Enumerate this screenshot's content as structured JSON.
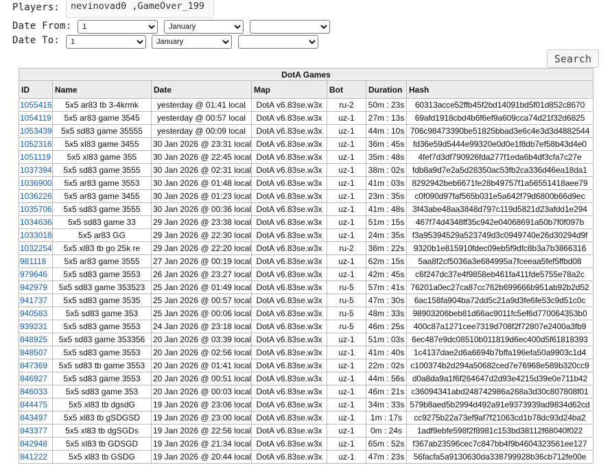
{
  "filters": {
    "players_label": "Players:",
    "players_value": "nevinovad0 ,GameOver_199",
    "date_from_label": "Date From:",
    "date_to_label": "Date To:",
    "from_day": "1",
    "from_month": "January",
    "from_year": "",
    "to_day": "1",
    "to_month": "January",
    "to_year": "",
    "search_label": "Search"
  },
  "table": {
    "title": "DotA Games",
    "headers": [
      "ID",
      "Name",
      "Date",
      "Map",
      "Bot",
      "Duration",
      "Hash"
    ],
    "rows": [
      {
        "id": "1055416",
        "name": "5x5 ar83 tb 3-4krmk",
        "date": "yesterday @ 01:41 local",
        "map": "DotA v6.83se.w3x",
        "bot": "ru-2",
        "duration": "50m : 23s",
        "hash": "60313acce52ffb45f2bd14091bd5f01d852c8670"
      },
      {
        "id": "1054119",
        "name": "5x5 ar83 game 3545",
        "date": "yesterday @ 00:57 local",
        "map": "DotA v6.83se.w3x",
        "bot": "uz-1",
        "duration": "27m : 13s",
        "hash": "69afd1918cbd4b6f6ef9a609cca74d21f32d6825"
      },
      {
        "id": "1053439",
        "name": "5x5 sd83 game 35555",
        "date": "yesterday @ 00:09 local",
        "map": "DotA v6.83se.w3x",
        "bot": "uz-1",
        "duration": "44m : 10s",
        "hash": "706c98473390be51825bbad3e6c4e3d3d4882544"
      },
      {
        "id": "1052316",
        "name": "5x5 xl83 game 3455",
        "date": "30 Jan 2026 @ 23:31 local",
        "map": "DotA v6.83se.w3x",
        "bot": "uz-1",
        "duration": "36m : 45s",
        "hash": "fd36e59d5444e99320e0d0e1f8db7ef58b43d4e0"
      },
      {
        "id": "1051119",
        "name": "5x5 xl83 game 355",
        "date": "30 Jan 2026 @ 22:45 local",
        "map": "DotA v6.83se.w3x",
        "bot": "uz-1",
        "duration": "35m : 48s",
        "hash": "4fef7d3df790926fda277f1eda6b4df3cfa7c27e"
      },
      {
        "id": "1037394",
        "name": "5x5 sd83 game 3555",
        "date": "30 Jan 2026 @ 02:31 local",
        "map": "DotA v6.83se.w3x",
        "bot": "uz-1",
        "duration": "38m : 02s",
        "hash": "fdb8a9d7e2a5d28350ac53fb2ca336d46ea18da1"
      },
      {
        "id": "1036900",
        "name": "5x5 ar83 game 3553",
        "date": "30 Jan 2026 @ 01:48 local",
        "map": "DotA v6.83se.w3x",
        "bot": "uz-1",
        "duration": "41m : 03s",
        "hash": "8292942beb6671fe28b49757f1a56551418aee79"
      },
      {
        "id": "1036226",
        "name": "5x5 ar83 game 3455",
        "date": "30 Jan 2026 @ 01:23 local",
        "map": "DotA v6.83se.w3x",
        "bot": "uz-1",
        "duration": "23m : 35s",
        "hash": "c0f090d97faf565b031e5a642f79d6800b66d9ec"
      },
      {
        "id": "1035706",
        "name": "5x5 sd83 game 3555",
        "date": "30 Jan 2026 @ 00:36 local",
        "map": "DotA v6.83se.w3x",
        "bot": "uz-1",
        "duration": "41m : 48s",
        "hash": "3f43abe48aa3848d797c119d5821d23afdd1e294"
      },
      {
        "id": "1034636",
        "name": "5x5 sd83 game 33",
        "date": "29 Jan 2026 @ 23:38 local",
        "map": "DotA v6.83se.w3x",
        "bot": "uz-1",
        "duration": "51m : 15s",
        "hash": "467f74d4348ff35c942e04068691a50b7f0f097b"
      },
      {
        "id": "1033018",
        "name": "5x5 ar83 GG",
        "date": "29 Jan 2026 @ 22:30 local",
        "map": "DotA v6.83se.w3x",
        "bot": "uz-1",
        "duration": "24m : 35s",
        "hash": "f3a95394529a523749d3c0949740e26d30294d9f"
      },
      {
        "id": "1032254",
        "name": "5x5 xl83 tb go 25k re",
        "date": "29 Jan 2026 @ 22:20 local",
        "map": "DotA v6.83se.w3x",
        "bot": "ru-2",
        "duration": "36m : 22s",
        "hash": "9320b1e815910fdec09eb5f9dfc8b3a7b3866316"
      },
      {
        "id": "981118",
        "name": "5x5 ar83 game 3555",
        "date": "27 Jan 2026 @ 00:19 local",
        "map": "DotA v6.83se.w3x",
        "bot": "uz-1",
        "duration": "62m : 15s",
        "hash": "5aa8f2cf5036a3e684995a7fceeaa5fef5ffbd08"
      },
      {
        "id": "979646",
        "name": "5x5 sd83 game 3553",
        "date": "26 Jan 2026 @ 23:27 local",
        "map": "DotA v6.83se.w3x",
        "bot": "uz-1",
        "duration": "42m : 45s",
        "hash": "c6f247dc37e4f9858eb461fa411fde5755e78a2c"
      },
      {
        "id": "942979",
        "name": "5x5 sd83 game 353523",
        "date": "25 Jan 2026 @ 01:49 local",
        "map": "DotA v6.83se.w3x",
        "bot": "ru-5",
        "duration": "57m : 41s",
        "hash": "76201a0ec27ca87cc762b699666b951ab92b2d52"
      },
      {
        "id": "941737",
        "name": "5x5 sd83 game 3535",
        "date": "25 Jan 2026 @ 00:57 local",
        "map": "DotA v6.83se.w3x",
        "bot": "ru-5",
        "duration": "47m : 30s",
        "hash": "6ac158fa904ba72dd5c21a9d3fe6fe53c9d51c0c"
      },
      {
        "id": "940583",
        "name": "5x5 sd83 game 353",
        "date": "25 Jan 2026 @ 00:06 local",
        "map": "DotA v6.83se.w3x",
        "bot": "ru-5",
        "duration": "48m : 33s",
        "hash": "98903206beb81d66ac9011fc5ef6d770064353b0"
      },
      {
        "id": "939231",
        "name": "5x5 sd83 game 3553",
        "date": "24 Jan 2026 @ 23:18 local",
        "map": "DotA v6.83se.w3x",
        "bot": "ru-5",
        "duration": "46m : 25s",
        "hash": "400c87a1271cee7319d708f2f72807e2400a3fb9"
      },
      {
        "id": "848925",
        "name": "5x5 sd83 game 353356",
        "date": "20 Jan 2026 @ 03:39 local",
        "map": "DotA v6.83se.w3x",
        "bot": "uz-1",
        "duration": "51m : 03s",
        "hash": "6ec487e9dc08510b011819d6ec400d5f61818393"
      },
      {
        "id": "848507",
        "name": "5x5 sd83 game 3553",
        "date": "20 Jan 2026 @ 02:56 local",
        "map": "DotA v6.83se.w3x",
        "bot": "uz-1",
        "duration": "41m : 40s",
        "hash": "1c4137dae2d6a6694b7bffa196efa50a9903c1d4"
      },
      {
        "id": "847369",
        "name": "5x5 sd83 tb game 3553",
        "date": "20 Jan 2026 @ 01:41 local",
        "map": "DotA v6.83se.w3x",
        "bot": "uz-1",
        "duration": "22m : 02s",
        "hash": "c100374b2d294a50682ced7e76968e589b320cc9"
      },
      {
        "id": "846927",
        "name": "5x5 sd83 game 3553",
        "date": "20 Jan 2026 @ 00:51 local",
        "map": "DotA v6.83se.w3x",
        "bot": "uz-1",
        "duration": "44m : 56s",
        "hash": "d0a8da9a1f6f264647d2d93e4215d39e0e711b42"
      },
      {
        "id": "846033",
        "name": "5x5 sd83 game 353",
        "date": "20 Jan 2026 @ 00:03 local",
        "map": "DotA v6.83se.w3x",
        "bot": "uz-1",
        "duration": "46m : 21s",
        "hash": "c36094341abd248742986a268a3d30c807808f01"
      },
      {
        "id": "844475",
        "name": "5x5 xl83 tb dgsdG",
        "date": "19 Jan 2026 @ 23:06 local",
        "map": "DotA v6.83se.w3x",
        "bot": "uz-1",
        "duration": "34m : 33s",
        "hash": "579b8aed5b2994d492a91e9373939ad9834d62cd"
      },
      {
        "id": "843497",
        "name": "5x5 xl83 tb gSDGSD",
        "date": "19 Jan 2026 @ 23:00 local",
        "map": "DotA v6.83se.w3x",
        "bot": "uz-1",
        "duration": "1m : 17s",
        "hash": "cc9275b22a73ef9af7f21063cd1b78dc93d24ba2"
      },
      {
        "id": "843377",
        "name": "5x5 xl83 tb dgSGDs",
        "date": "19 Jan 2026 @ 22:56 local",
        "map": "DotA v6.83se.w3x",
        "bot": "uz-1",
        "duration": "0m : 24s",
        "hash": "1adf9ebfe598f2f8981c153bd38112f68040f022"
      },
      {
        "id": "842948",
        "name": "5x5 xl83 tb GDSGD",
        "date": "19 Jan 2026 @ 21:34 local",
        "map": "DotA v6.83se.w3x",
        "bot": "uz-1",
        "duration": "65m : 52s",
        "hash": "f367ab23596cec7c847bb4f9b4604323561ee127"
      },
      {
        "id": "841222",
        "name": "5x5 xl83 tb GSDG",
        "date": "19 Jan 2026 @ 20:44 local",
        "map": "DotA v6.83se.w3x",
        "bot": "uz-1",
        "duration": "47m : 23s",
        "hash": "56facfa5a9130630da338799928b36cb712fe00e"
      }
    ]
  }
}
